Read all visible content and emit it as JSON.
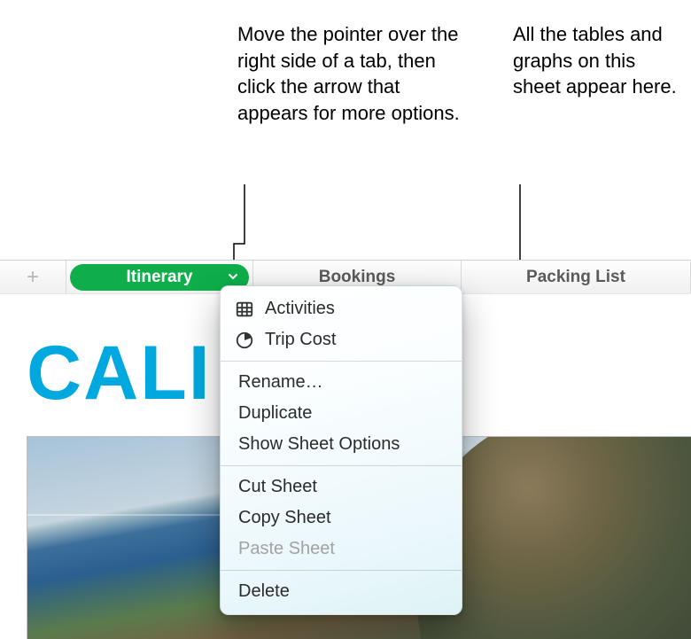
{
  "callouts": {
    "left": "Move the pointer over the right side of a tab, then click the arrow that appears for more options.",
    "right": "All the tables and graphs on this sheet appear here."
  },
  "tabs": {
    "active": "Itinerary",
    "second": "Bookings",
    "third": "Packing List"
  },
  "sheet": {
    "big_title": "CALI"
  },
  "menu": {
    "object_table": "Activities",
    "object_chart": "Trip Cost",
    "rename": "Rename…",
    "duplicate": "Duplicate",
    "show_options": "Show Sheet Options",
    "cut": "Cut Sheet",
    "copy": "Copy Sheet",
    "paste": "Paste Sheet",
    "delete": "Delete"
  }
}
